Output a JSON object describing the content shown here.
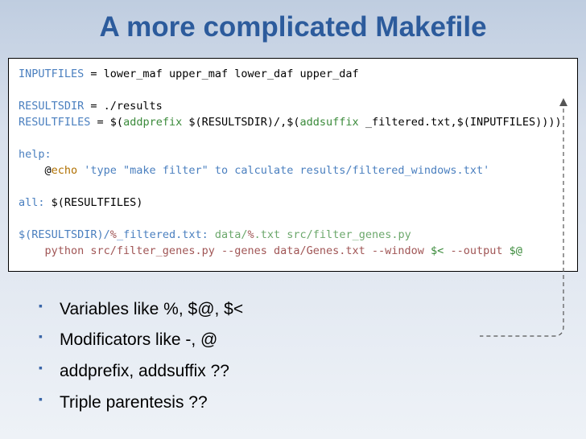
{
  "title": "A more complicated Makefile",
  "code": {
    "l1a": "INPUTFILES",
    "l1b": " = lower_maf upper_maf lower_daf upper_daf",
    "l3a": "RESULTSDIR",
    "l3b": " = ./results",
    "l4a": "RESULTFILES",
    "l4b": " = ",
    "l4c": "$(",
    "l4d": "addprefix",
    "l4e": " $(RESULTSDIR)/,",
    "l4f": "$(",
    "l4g": "addsuffix",
    "l4h": " _filtered.txt,$(INPUTFILES)",
    "l4i": "))",
    "l4j": ")",
    "l6a": "help:",
    "l7a": "    @",
    "l7b": "echo",
    "l7c": " 'type \"make filter\" to calculate results/filtered_windows.txt'",
    "l9a": "all:",
    "l9b": " $(RESULTFILES)",
    "l11a": "$(RESULTSDIR)/",
    "l11b": "%",
    "l11c": "_filtered.txt:",
    "l11d": " data/",
    "l11e": "%",
    "l11f": ".txt src/filter_genes.py",
    "l12a": "    python src/filter_genes.py --genes data/Genes.txt --window ",
    "l12b": "$<",
    "l12c": " --output ",
    "l12d": "$@"
  },
  "bullets": [
    "Variables like %, $@, $<",
    "Modificators like -, @",
    "addprefix, addsuffix ??",
    "Triple parentesis ??"
  ]
}
